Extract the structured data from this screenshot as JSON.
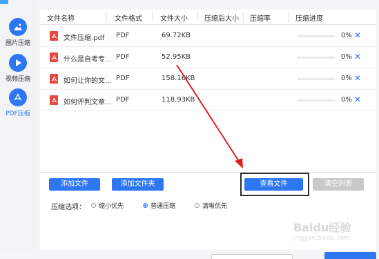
{
  "sidebar": {
    "items": [
      {
        "label": "图片压缩",
        "icon": "image-icon"
      },
      {
        "label": "视频压缩",
        "icon": "play-icon"
      },
      {
        "label": "PDF压缩",
        "icon": "pdf-icon"
      }
    ],
    "active": "PDF压缩"
  },
  "table": {
    "headers": [
      "文件名称",
      "文件格式",
      "文件大小",
      "压缩后大小",
      "压缩率",
      "压缩进度"
    ],
    "rows": [
      {
        "name": "文件压缩.pdf",
        "format": "PDF",
        "size": "69.72KB",
        "after": "",
        "ratio": "",
        "progress": 0,
        "progress_text": "0%"
      },
      {
        "name": "什么是自考专...",
        "format": "PDF",
        "size": "52.95KB",
        "after": "",
        "ratio": "",
        "progress": 0,
        "progress_text": "0%"
      },
      {
        "name": "如何让你的文...",
        "format": "PDF",
        "size": "158.16KB",
        "after": "",
        "ratio": "",
        "progress": 0,
        "progress_text": "0%"
      },
      {
        "name": "如何评判文章...",
        "format": "PDF",
        "size": "118.93KB",
        "after": "",
        "ratio": "",
        "progress": 0,
        "progress_text": "0%"
      }
    ]
  },
  "buttons": {
    "add_file": "添加文件",
    "add_folder": "添加文件夹",
    "view_files": "查看文件",
    "clear_list": "清空列表"
  },
  "options": {
    "label": "压缩选项：",
    "choices": [
      "缩小优先",
      "普通压缩",
      "清晰优先"
    ],
    "selected": "普通压缩"
  },
  "watermark": {
    "main": "Baidu经验",
    "sub": "jingyan.baidu.com"
  },
  "colors": {
    "accent": "#2d77f2",
    "pdf_red": "#e8453c",
    "annotation_red": "#e02020",
    "disabled_gray": "#c9c9c9"
  }
}
